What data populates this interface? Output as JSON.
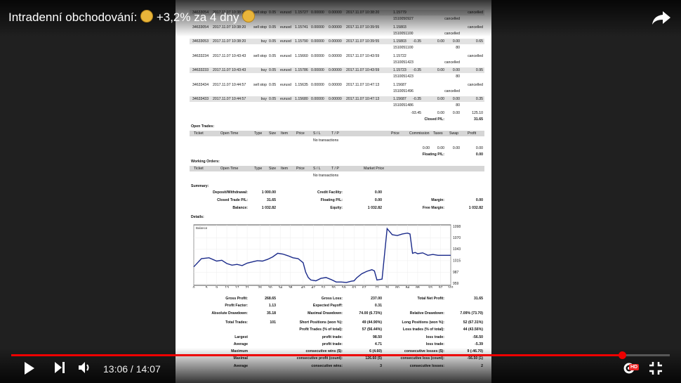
{
  "video": {
    "title": "Intradenní obchodování: 💰 +3,2% za 4 dny 💰",
    "title_parts": [
      "Intradenní obchodování: ",
      " +3,2% za 4 dny "
    ],
    "current_time": "13:06",
    "duration": "14:07",
    "time_display": "13:06 / 14:07",
    "progress_fraction": 0.928,
    "quality_badge": "HD",
    "accent_color": "#e00000"
  },
  "trades": [
    {
      "ticket": "34633054",
      "time": "2017.11.07 10:38:20",
      "type": "sell stop",
      "size": "0.05",
      "item": "eurusd",
      "price": "1.15727",
      "sl": "0.00000",
      "tp": "0.00000",
      "ctime": "2017.11.07 10:38:20",
      "cprice": "1.15779",
      "comm": "",
      "taxes": "",
      "swap": "",
      "profit": "cancelled",
      "sub": "1510050927",
      "subnote": "cancelled"
    },
    {
      "ticket": "34633054",
      "time": "2017.11.07 10:38:20",
      "type": "sell stop",
      "size": "0.05",
      "item": "eurusd",
      "price": "1.15741",
      "sl": "0.00000",
      "tp": "0.00000",
      "ctime": "2017.11.07 10:39:55",
      "cprice": "1.15803",
      "comm": "",
      "taxes": "",
      "swap": "",
      "profit": "cancelled",
      "sub": "1510051100",
      "subnote": "cancelled"
    },
    {
      "ticket": "34633053",
      "time": "2017.11.07 10:38:20",
      "type": "buy",
      "size": "0.05",
      "item": "eurusd",
      "price": "1.15790",
      "sl": "0.00000",
      "tp": "0.00000",
      "ctime": "2017.11.07 10:39:55",
      "cprice": "1.15803",
      "comm": "-0.35",
      "taxes": "0.00",
      "swap": "0.00",
      "profit": "0.65",
      "sub": "1510051100",
      "subnote": "80"
    },
    {
      "ticket": "34633234",
      "time": "2017.11.07 10:43:43",
      "type": "sell stop",
      "size": "0.05",
      "item": "eurusd",
      "price": "1.15660",
      "sl": "0.00000",
      "tp": "0.00000",
      "ctime": "2017.11.07 10:43:59",
      "cprice": "1.15722",
      "comm": "",
      "taxes": "",
      "swap": "",
      "profit": "cancelled",
      "sub": "1510051423",
      "subnote": "cancelled"
    },
    {
      "ticket": "34633233",
      "time": "2017.11.07 10:43:43",
      "type": "buy",
      "size": "0.05",
      "item": "eurusd",
      "price": "1.15786",
      "sl": "0.00000",
      "tp": "0.00000",
      "ctime": "2017.11.07 10:43:59",
      "cprice": "1.15723",
      "comm": "-0.35",
      "taxes": "0.00",
      "swap": "0.00",
      "profit": "0.95",
      "sub": "1510051423",
      "subnote": "80"
    },
    {
      "ticket": "34633434",
      "time": "2017.11.07 10:44:57",
      "type": "sell stop",
      "size": "0.05",
      "item": "eurusd",
      "price": "1.15635",
      "sl": "0.00000",
      "tp": "0.00000",
      "ctime": "2017.11.07 10:47:13",
      "cprice": "1.15687",
      "comm": "",
      "taxes": "",
      "swap": "",
      "profit": "cancelled",
      "sub": "1510051496",
      "subnote": "cancelled"
    },
    {
      "ticket": "34633433",
      "time": "2017.11.07 10:44:57",
      "type": "buy",
      "size": "0.05",
      "item": "eurusd",
      "price": "1.15680",
      "sl": "0.00000",
      "tp": "0.00000",
      "ctime": "2017.11.07 10:47:13",
      "cprice": "1.15687",
      "comm": "-0.35",
      "taxes": "0.00",
      "swap": "0.00",
      "profit": "0.35",
      "sub": "1510051486",
      "subnote": "80"
    }
  ],
  "closed_totals": {
    "comm": "-93.45",
    "taxes": "0.00",
    "swap": "0.00",
    "profit": "125.10",
    "label": "Closed P/L:",
    "value": "31.65"
  },
  "open_trades": {
    "heading": "Open Trades:",
    "cols": [
      "Ticket",
      "Open Time",
      "Type",
      "Size",
      "Item",
      "Price",
      "S / L",
      "T / P",
      "",
      "Price",
      "Commission",
      "Taxes",
      "Swap",
      "Profit"
    ],
    "empty": "No transactions",
    "totals": {
      "comm": "0.00",
      "taxes": "0.00",
      "swap": "0.00",
      "profit": "0.00"
    },
    "float_label": "Floating P/L:",
    "float_value": "0.00"
  },
  "working_orders": {
    "heading": "Working Orders:",
    "cols": [
      "Ticket",
      "Open Time",
      "Type",
      "Size",
      "Item",
      "Price",
      "S / L",
      "T / P",
      "Market Price"
    ],
    "empty": "No transactions"
  },
  "summary": {
    "heading": "Summary:",
    "rows": [
      {
        "l1": "Deposit/Withdrawal:",
        "v1": "1 000.00",
        "l2": "Credit Facility:",
        "v2": "0.00",
        "l3": "",
        "v3": ""
      },
      {
        "l1": "Closed Trade P/L:",
        "v1": "31.65",
        "l2": "Floating P/L:",
        "v2": "0.00",
        "l3": "Margin:",
        "v3": "0.00"
      },
      {
        "l1": "Balance:",
        "v1": "1 032.82",
        "l2": "Equity:",
        "v2": "1 032.82",
        "l3": "Free Margin:",
        "v3": "1 032.82"
      }
    ]
  },
  "details": {
    "heading": "Details:",
    "rows": [
      {
        "l1": "Gross Profit:",
        "v1": "268.65",
        "l2": "Gross Loss:",
        "v2": "237.00",
        "l3": "Total Net Profit:",
        "v3": "31.65"
      },
      {
        "l1": "Profit Factor:",
        "v1": "1.13",
        "l2": "Expected Payoff:",
        "v2": "0.31",
        "l3": "",
        "v3": ""
      },
      {
        "l1": "Absolute Drawdown:",
        "v1": "35.18",
        "l2": "Maximal Drawdown:",
        "v2": "74.00 (6.73%)",
        "l3": "Relative Drawdown:",
        "v3": "7.09% (73.70)"
      },
      {
        "l1": "Total Trades:",
        "v1": "101",
        "l2": "Short Positions (won %):",
        "v2": "49 (44.90%)",
        "l3": "Long Positions (won %):",
        "v3": "52 (67.31%)"
      },
      {
        "l1": "",
        "v1": "",
        "l2": "Profit Trades (% of total):",
        "v2": "57 (56.44%)",
        "l3": "Loss trades (% of total):",
        "v3": "44 (43.56%)"
      },
      {
        "l1": "Largest",
        "v1": "",
        "l2": "profit trade:",
        "v2": "98.50",
        "l3": "loss trade:",
        "v3": "-56.50"
      },
      {
        "l1": "Average",
        "v1": "",
        "l2": "profit trade:",
        "v2": "4.71",
        "l3": "loss trade:",
        "v3": "-5.39"
      },
      {
        "l1": "Maximum",
        "v1": "",
        "l2": "consecutive wins ($):",
        "v2": "6 (4.60)",
        "l3": "consecutive losses ($):",
        "v3": "9 (-46.70)"
      },
      {
        "l1": "Maximal",
        "v1": "",
        "l2": "consecutive profit (count):",
        "v2": "126.60 (5)",
        "l3": "consecutive loss (count):",
        "v3": "-56.50 (1)"
      },
      {
        "l1": "Average",
        "v1": "",
        "l2": "consecutive wins:",
        "v2": "3",
        "l3": "consecutive losses:",
        "v3": "2"
      }
    ]
  },
  "chart_data": {
    "type": "line",
    "title": "",
    "legend": "Balance",
    "xlabel": "",
    "ylabel": "",
    "x_ticks": [
      "0",
      "5",
      "9",
      "13",
      "17",
      "21",
      "26",
      "30",
      "34",
      "38",
      "43",
      "47",
      "51",
      "55",
      "59",
      "63",
      "67",
      "72",
      "76",
      "80",
      "84",
      "88",
      "93",
      "97",
      "101"
    ],
    "y_ticks": [
      "1098",
      "1070",
      "1043",
      "1015",
      "987",
      "959"
    ],
    "ylim": [
      955,
      1102
    ],
    "xlim": [
      0,
      101
    ],
    "color": "#1a2a8a",
    "series": [
      {
        "name": "Balance",
        "x": [
          0,
          3,
          6,
          9,
          11,
          13,
          15,
          17,
          19,
          21,
          23,
          25,
          27,
          29,
          31,
          33,
          35,
          37,
          39,
          41,
          43,
          44,
          45,
          46,
          48,
          50,
          52,
          54,
          56,
          58,
          60,
          62,
          63,
          64,
          66,
          68,
          70,
          71,
          72,
          74,
          76,
          78,
          80,
          82,
          84,
          85,
          86,
          87,
          88,
          90,
          92,
          94,
          96,
          98,
          101
        ],
        "y": [
          1000,
          1020,
          1022,
          1014,
          1016,
          1008,
          1004,
          1006,
          1003,
          1009,
          1012,
          1015,
          1014,
          1018,
          1024,
          1033,
          1031,
          1027,
          1022,
          1020,
          1010,
          987,
          974,
          968,
          966,
          972,
          974,
          969,
          963,
          963,
          962,
          965,
          966,
          973,
          983,
          989,
          993,
          990,
          968,
          970,
          1093,
          1078,
          1076,
          1080,
          1082,
          1080,
          1033,
          1035,
          1032,
          1034,
          1028,
          1030,
          1028,
          1028,
          1028
        ]
      }
    ]
  }
}
